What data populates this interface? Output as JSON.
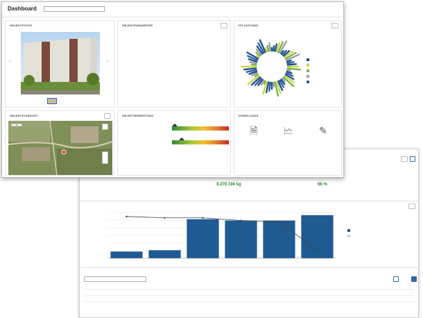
{
  "app": {
    "title": "Dashboard",
    "object_select": "",
    "breadcrumb": "",
    "export_label": ""
  },
  "panels": {
    "photos": {
      "title": "OBJEKTFOTOS",
      "nav_prev": "‹",
      "nav_next": "›"
    },
    "params": {
      "title": "OBJEKTPARAMETER",
      "rows": [
        {
          "key": "",
          "value": "",
          "unit": ""
        },
        {
          "key": "",
          "value": "",
          "unit": ""
        },
        {
          "key": "",
          "value": "",
          "unit": ""
        },
        {
          "key": "",
          "value": "",
          "unit": ""
        },
        {
          "key": "",
          "value": "",
          "unit": ""
        },
        {
          "key": "",
          "value": "",
          "unit": ""
        }
      ]
    },
    "ist": {
      "title": "IST-ZUSTAND",
      "center_label": "",
      "legend": [
        "",
        "",
        "",
        "",
        ""
      ],
      "legend_colors": [
        "#1f4e8c",
        "#c5d94a",
        "#7cb342",
        "#9aa0a6",
        "#2e5c9a"
      ]
    },
    "map": {
      "title": "OBJEKTSTANDORT",
      "layer_labels": [
        "",
        ""
      ]
    },
    "rating": {
      "title": "OBJEKTBEWERTUNG",
      "rows": [
        {
          "label": "",
          "sub": ""
        },
        {
          "label": "",
          "sub": ""
        }
      ]
    },
    "downloads": {
      "title": "DOWNLOADS",
      "items": [
        {
          "icon": "document-icon",
          "label": ""
        },
        {
          "icon": "file-chart-icon",
          "label": ""
        },
        {
          "icon": "file-edit-icon",
          "label": ""
        }
      ]
    }
  },
  "window2": {
    "top_button": "",
    "kpis": [
      {
        "value": "8.270.194 kg",
        "caption": ""
      },
      {
        "value": "66 %",
        "caption": ""
      }
    ],
    "chart_label": "",
    "table_title": "",
    "table_select": "",
    "table_buttons": [
      "",
      ""
    ],
    "table_years": [
      "",
      "",
      "",
      "",
      "",
      ""
    ],
    "table_rows": [
      {
        "label": "",
        "vals": [
          "",
          "",
          "",
          "",
          "",
          ""
        ]
      },
      {
        "label": "",
        "vals": [
          "",
          "",
          "",
          "",
          "",
          ""
        ]
      }
    ]
  },
  "chart_data": {
    "type": "bar",
    "title": "",
    "left_axis_label": "",
    "right_axis_label": "",
    "categories": [
      "",
      "",
      "",
      "",
      "",
      ""
    ],
    "series": [
      {
        "name": "",
        "type": "bar",
        "values": [
          0.5,
          0.6,
          2.9,
          2.8,
          2.8,
          3.2
        ]
      },
      {
        "name": "",
        "type": "line",
        "values": [
          3.1,
          3.0,
          3.0,
          2.8,
          2.7,
          0.6
        ]
      }
    ],
    "ylim": [
      0,
      3.4
    ],
    "legend_position": "right",
    "colors": {
      "bar": "#1f5a93",
      "line": "#444444"
    }
  },
  "colors": {
    "accent": "#3366aa",
    "kpi_green": "#2c8a2c",
    "rating_gradient": [
      "#2e8b3a",
      "#a7c83a",
      "#f1c232",
      "#e07b2c",
      "#c62828"
    ]
  }
}
